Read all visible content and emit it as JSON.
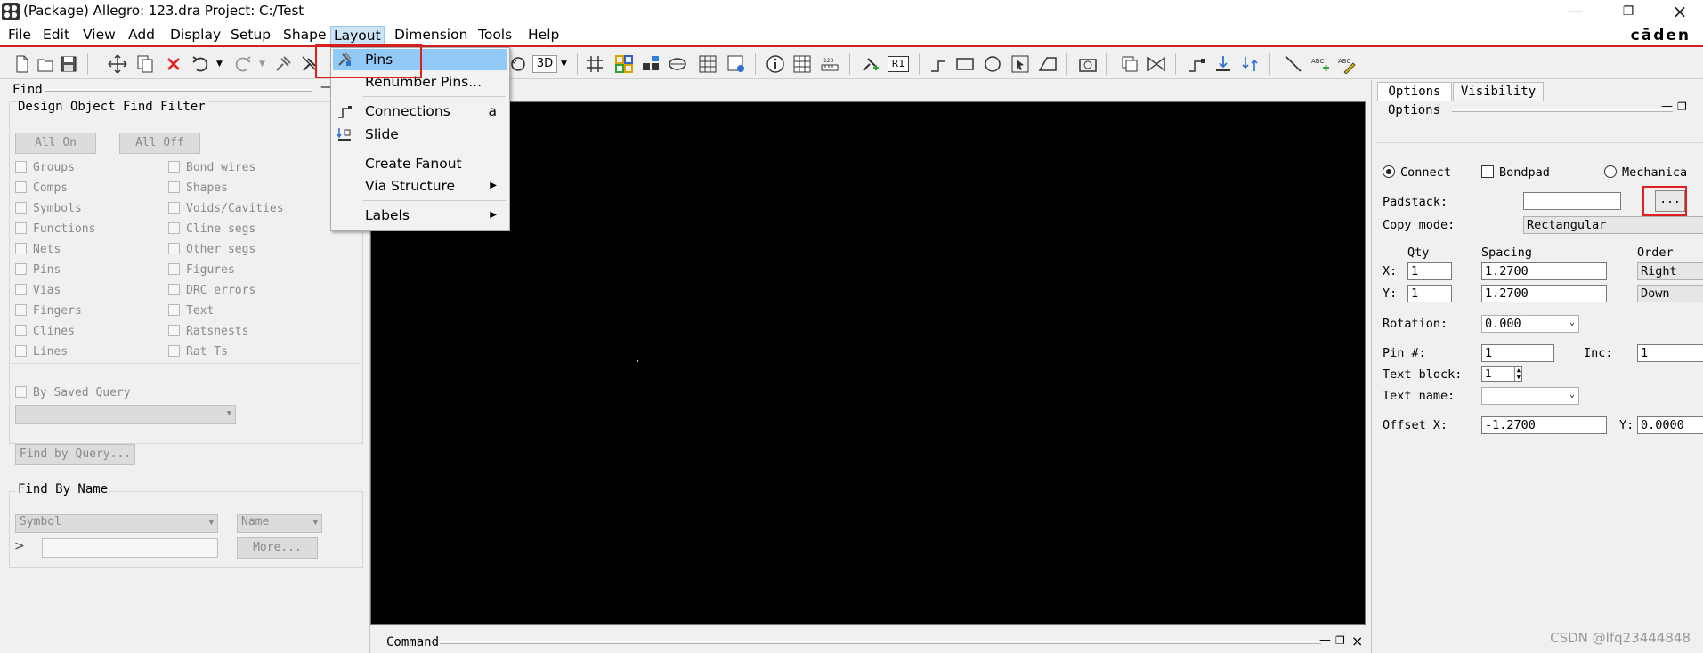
{
  "window": {
    "title": "(Package) Allegro: 123.dra  Project: C:/Test",
    "brand": "cāden"
  },
  "menubar": {
    "items": [
      "File",
      "Edit",
      "View",
      "Add",
      "Display",
      "Setup",
      "Shape",
      "Layout",
      "Dimension",
      "Tools",
      "Help"
    ],
    "active": "Layout"
  },
  "toolbar": {
    "view_3d_label": "3D",
    "r1_label": "R1"
  },
  "layout_menu": {
    "items": [
      {
        "label": "Pins",
        "icon": "pin-icon",
        "shortcut": "",
        "submenu": false
      },
      {
        "label": "Renumber Pins...",
        "icon": "",
        "shortcut": "",
        "submenu": false
      },
      {
        "label": "Connections",
        "icon": "connections-icon",
        "shortcut": "a",
        "submenu": false
      },
      {
        "label": "Slide",
        "icon": "slide-icon",
        "shortcut": "",
        "submenu": false
      },
      {
        "label": "Create Fanout",
        "icon": "",
        "shortcut": "",
        "submenu": false
      },
      {
        "label": "Via Structure",
        "icon": "",
        "shortcut": "",
        "submenu": true
      },
      {
        "label": "Labels",
        "icon": "",
        "shortcut": "",
        "submenu": true
      }
    ],
    "highlighted": "Pins"
  },
  "find_panel": {
    "title": "Find",
    "filter_title": "Design Object Find Filter",
    "all_on": "All On",
    "all_off": "All Off",
    "left_column": [
      "Groups",
      "Comps",
      "Symbols",
      "Functions",
      "Nets",
      "Pins",
      "Vias",
      "Fingers",
      "Clines",
      "Lines"
    ],
    "right_column": [
      "Bond wires",
      "Shapes",
      "Voids/Cavities",
      "Cline segs",
      "Other segs",
      "Figures",
      "DRC errors",
      "Text",
      "Ratsnests",
      "Rat Ts"
    ],
    "by_saved_query": "By Saved Query",
    "find_by_query": "Find by Query...",
    "find_by_name_title": "Find By Name",
    "name_type": "Symbol",
    "name_mode": "Name",
    "more_button": "More...",
    "expand_glyph": ">"
  },
  "command_panel": {
    "title": "Command"
  },
  "options_panel": {
    "tabs": [
      "Options",
      "Visibility"
    ],
    "active_tab": "Options",
    "title": "Options",
    "radio_connect": "Connect",
    "check_bondpad": "Bondpad",
    "radio_mechanical": "Mechanica",
    "padstack_label": "Padstack:",
    "padstack_value": "",
    "browse_button": "...",
    "copy_mode_label": "Copy mode:",
    "copy_mode_value": "Rectangular",
    "qty_header": "Qty",
    "spacing_header": "Spacing",
    "order_header": "Order",
    "x_label": "X:",
    "y_label": "Y:",
    "x_qty": "1",
    "y_qty": "1",
    "x_spacing": "1.2700",
    "y_spacing": "1.2700",
    "x_order": "Right",
    "y_order": "Down",
    "rotation_label": "Rotation:",
    "rotation_value": "0.000",
    "pin_label": "Pin #:",
    "pin_value": "1",
    "inc_label": "Inc:",
    "inc_value": "1",
    "text_block_label": "Text block:",
    "text_block_value": "1",
    "text_name_label": "Text name:",
    "text_name_value": "",
    "offset_x_label": "Offset X:",
    "offset_x_value": "-1.2700",
    "offset_y_label": "Y:",
    "offset_y_value": "0.0000"
  },
  "watermark": "CSDN @lfq23444848",
  "accent_color": "#e02020",
  "menu_highlight_color": "#91c9f7"
}
